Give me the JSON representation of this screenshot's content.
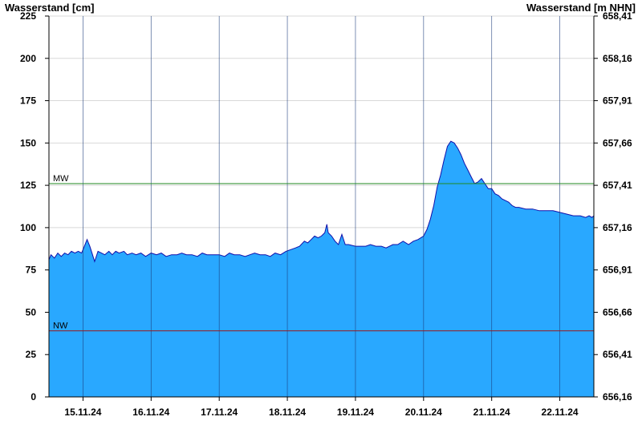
{
  "chart_data": {
    "type": "area",
    "title": "",
    "ylabel_left": "Wasserstand [cm]",
    "ylabel_right": "Wasserstand [m NHN]",
    "ylim": [
      0,
      225
    ],
    "y_ticks_left": [
      0,
      25,
      50,
      75,
      100,
      125,
      150,
      175,
      200,
      225
    ],
    "y_ticks_right": [
      "656,16",
      "656,41",
      "656,66",
      "656,91",
      "657,16",
      "657,41",
      "657,66",
      "657,91",
      "658,16",
      "658,41"
    ],
    "x_tick_labels": [
      "15.11.24",
      "16.11.24",
      "17.11.24",
      "18.11.24",
      "19.11.24",
      "20.11.24",
      "21.11.24",
      "22.11.24"
    ],
    "x_range_days": [
      14.5,
      22.5
    ],
    "grid": "horizontal",
    "fill_color": "#29a8ff",
    "line_color": "#1010aa",
    "reference_lines": [
      {
        "label": "MW",
        "value": 126,
        "color": "#1f8a1f"
      },
      {
        "label": "NW",
        "value": 39,
        "color": "#9b1b1b"
      }
    ],
    "series": [
      {
        "values": [
          [
            14.5,
            81
          ],
          [
            14.53,
            84
          ],
          [
            14.58,
            82
          ],
          [
            14.63,
            85
          ],
          [
            14.68,
            83
          ],
          [
            14.73,
            85
          ],
          [
            14.78,
            84
          ],
          [
            14.83,
            86
          ],
          [
            14.88,
            85
          ],
          [
            14.93,
            86
          ],
          [
            14.98,
            85
          ],
          [
            15.03,
            90
          ],
          [
            15.06,
            93
          ],
          [
            15.1,
            89
          ],
          [
            15.14,
            84
          ],
          [
            15.17,
            80
          ],
          [
            15.22,
            86
          ],
          [
            15.27,
            85
          ],
          [
            15.32,
            84
          ],
          [
            15.38,
            86
          ],
          [
            15.43,
            84
          ],
          [
            15.48,
            86
          ],
          [
            15.53,
            85
          ],
          [
            15.6,
            86
          ],
          [
            15.65,
            84
          ],
          [
            15.72,
            85
          ],
          [
            15.78,
            84
          ],
          [
            15.85,
            85
          ],
          [
            15.92,
            83
          ],
          [
            16.0,
            85
          ],
          [
            16.08,
            84
          ],
          [
            16.15,
            85
          ],
          [
            16.22,
            83
          ],
          [
            16.3,
            84
          ],
          [
            16.38,
            84
          ],
          [
            16.45,
            85
          ],
          [
            16.52,
            84
          ],
          [
            16.6,
            84
          ],
          [
            16.68,
            83
          ],
          [
            16.75,
            85
          ],
          [
            16.82,
            84
          ],
          [
            16.9,
            84
          ],
          [
            17.0,
            84
          ],
          [
            17.08,
            83
          ],
          [
            17.15,
            85
          ],
          [
            17.22,
            84
          ],
          [
            17.3,
            84
          ],
          [
            17.38,
            83
          ],
          [
            17.45,
            84
          ],
          [
            17.52,
            85
          ],
          [
            17.6,
            84
          ],
          [
            17.68,
            84
          ],
          [
            17.75,
            83
          ],
          [
            17.82,
            85
          ],
          [
            17.9,
            84
          ],
          [
            17.98,
            86
          ],
          [
            18.05,
            87
          ],
          [
            18.12,
            88
          ],
          [
            18.18,
            89
          ],
          [
            18.25,
            92
          ],
          [
            18.3,
            91
          ],
          [
            18.35,
            93
          ],
          [
            18.4,
            95
          ],
          [
            18.45,
            94
          ],
          [
            18.5,
            95
          ],
          [
            18.55,
            97
          ],
          [
            18.58,
            102
          ],
          [
            18.6,
            97
          ],
          [
            18.65,
            95
          ],
          [
            18.7,
            92
          ],
          [
            18.75,
            90
          ],
          [
            18.8,
            96
          ],
          [
            18.85,
            90
          ],
          [
            18.9,
            90
          ],
          [
            19.0,
            89
          ],
          [
            19.08,
            89
          ],
          [
            19.15,
            89
          ],
          [
            19.22,
            90
          ],
          [
            19.3,
            89
          ],
          [
            19.38,
            89
          ],
          [
            19.45,
            88
          ],
          [
            19.55,
            90
          ],
          [
            19.62,
            90
          ],
          [
            19.7,
            92
          ],
          [
            19.78,
            90
          ],
          [
            19.85,
            92
          ],
          [
            19.92,
            93
          ],
          [
            20.0,
            95
          ],
          [
            20.05,
            99
          ],
          [
            20.1,
            105
          ],
          [
            20.15,
            113
          ],
          [
            20.2,
            124
          ],
          [
            20.25,
            131
          ],
          [
            20.3,
            140
          ],
          [
            20.35,
            148
          ],
          [
            20.4,
            151
          ],
          [
            20.45,
            150
          ],
          [
            20.5,
            147
          ],
          [
            20.55,
            143
          ],
          [
            20.6,
            138
          ],
          [
            20.65,
            134
          ],
          [
            20.7,
            130
          ],
          [
            20.75,
            126
          ],
          [
            20.8,
            127
          ],
          [
            20.85,
            129
          ],
          [
            20.9,
            126
          ],
          [
            20.95,
            123
          ],
          [
            21.0,
            123
          ],
          [
            21.05,
            120
          ],
          [
            21.1,
            119
          ],
          [
            21.15,
            117
          ],
          [
            21.2,
            116
          ],
          [
            21.25,
            115
          ],
          [
            21.3,
            113
          ],
          [
            21.35,
            112
          ],
          [
            21.4,
            112
          ],
          [
            21.5,
            111
          ],
          [
            21.6,
            111
          ],
          [
            21.7,
            110
          ],
          [
            21.8,
            110
          ],
          [
            21.9,
            110
          ],
          [
            22.0,
            109
          ],
          [
            22.1,
            108
          ],
          [
            22.2,
            107
          ],
          [
            22.3,
            107
          ],
          [
            22.38,
            106
          ],
          [
            22.43,
            107
          ],
          [
            22.47,
            106
          ],
          [
            22.5,
            107
          ]
        ]
      }
    ]
  }
}
